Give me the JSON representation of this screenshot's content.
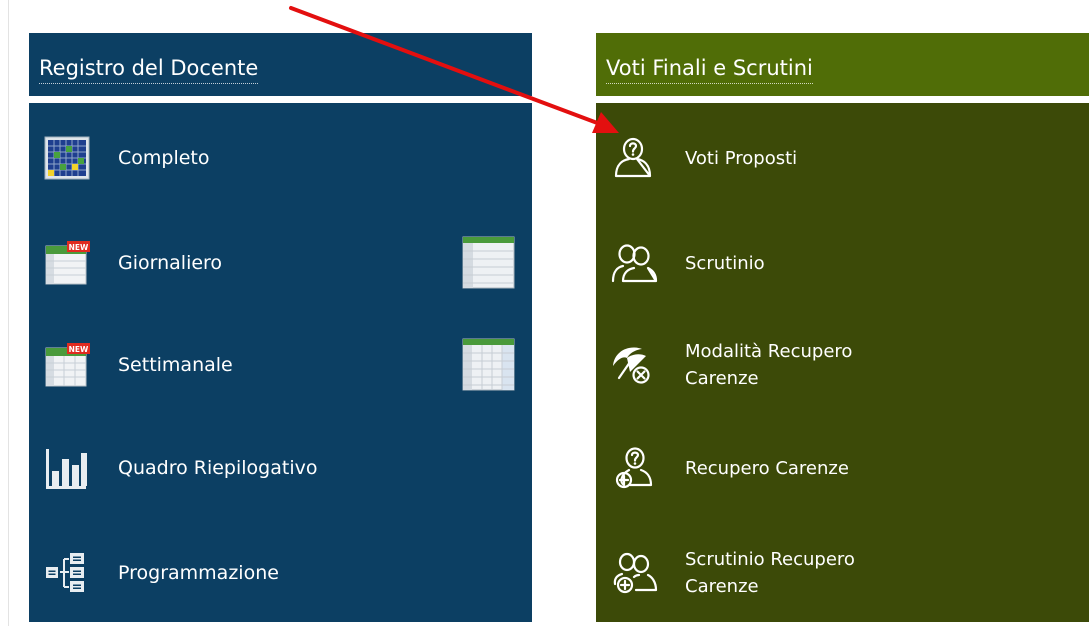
{
  "registro": {
    "title": "Registro del Docente",
    "items": [
      {
        "label": "Completo",
        "icon": "calendar-grid-icon"
      },
      {
        "label": "Giornaliero",
        "icon": "new-daily-register-icon",
        "side_icon": "daily-view-icon"
      },
      {
        "label": "Settimanale",
        "icon": "new-weekly-register-icon",
        "side_icon": "weekly-view-icon"
      },
      {
        "label": "Quadro Riepilogativo",
        "icon": "bar-chart-icon"
      },
      {
        "label": "Programmazione",
        "icon": "hierarchy-tree-icon"
      }
    ]
  },
  "voti": {
    "title": "Voti Finali e Scrutini",
    "items": [
      {
        "label": "Voti Proposti",
        "icon": "user-question-icon"
      },
      {
        "label": "Scrutinio",
        "icon": "users-group-icon"
      },
      {
        "label_line1": "Modalità Recupero",
        "label_line2": "Carenze",
        "icon": "umbrella-cancel-icon"
      },
      {
        "label": "Recupero Carenze",
        "icon": "user-question-add-icon"
      },
      {
        "label_line1": "Scrutinio Recupero",
        "label_line2": "Carenze",
        "icon": "users-group-add-icon"
      }
    ]
  },
  "colors": {
    "registro_panel": "#0c3f63",
    "voti_header": "#506d07",
    "voti_body": "#3c4a08",
    "annotation_arrow": "#e30f0f"
  }
}
